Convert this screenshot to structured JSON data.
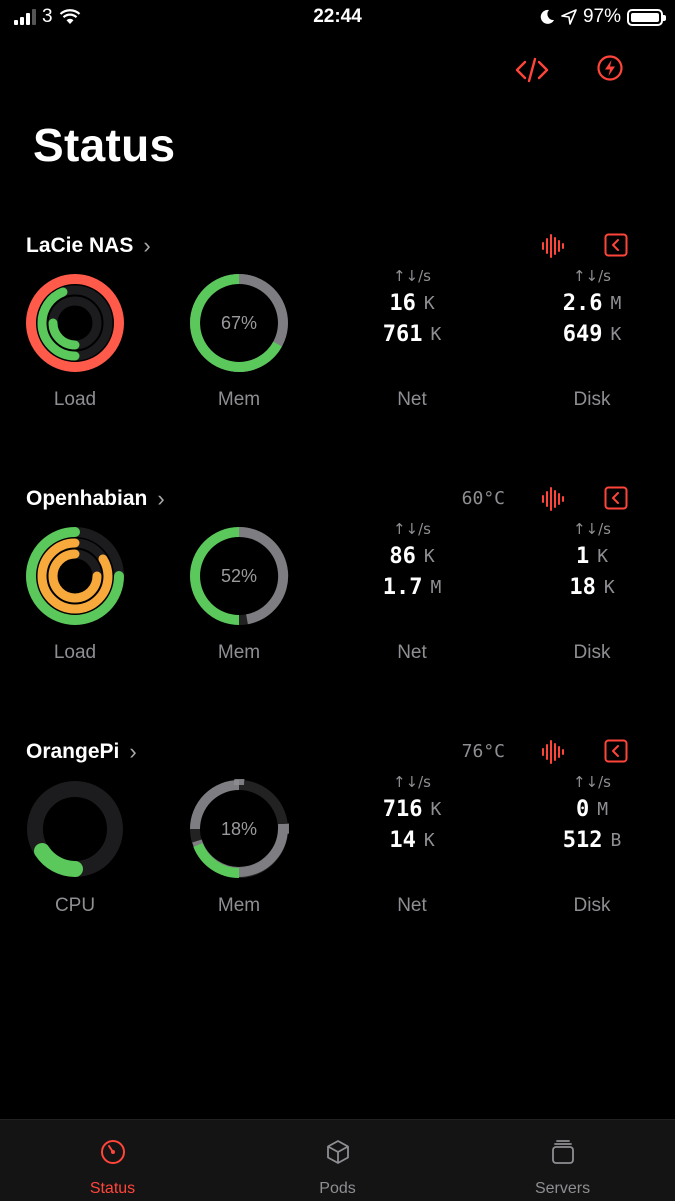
{
  "status_bar": {
    "carrier": "3",
    "time": "22:44",
    "battery": "97%"
  },
  "page": {
    "title": "Status"
  },
  "colors": {
    "accent": "#ff453a",
    "green": "#5ac85a",
    "orange": "#f7a93b",
    "track": "#2a2a2c",
    "gray": "#8e8e93"
  },
  "servers": [
    {
      "name": "LaCie NAS",
      "temp": "",
      "gauge1_label": "Load",
      "mem_pct": "67%",
      "mem_label": "Mem",
      "net": {
        "arrows": "↑↓/s",
        "up": "16",
        "up_unit": "K",
        "down": "761",
        "down_unit": "K",
        "label": "Net"
      },
      "disk": {
        "arrows": "↑↓/s",
        "read": "2.6",
        "read_unit": "M",
        "write": "649",
        "write_unit": "K",
        "label": "Disk"
      }
    },
    {
      "name": "Openhabian",
      "temp": "60°C",
      "gauge1_label": "Load",
      "mem_pct": "52%",
      "mem_label": "Mem",
      "net": {
        "arrows": "↑↓/s",
        "up": "86",
        "up_unit": "K",
        "down": "1.7",
        "down_unit": "M",
        "label": "Net"
      },
      "disk": {
        "arrows": "↑↓/s",
        "read": "1",
        "read_unit": "K",
        "write": "18",
        "write_unit": "K",
        "label": "Disk"
      }
    },
    {
      "name": "OrangePi",
      "temp": "76°C",
      "gauge1_label": "CPU",
      "mem_pct": "18%",
      "mem_label": "Mem",
      "net": {
        "arrows": "↑↓/s",
        "up": "716",
        "up_unit": "K",
        "down": "14",
        "down_unit": "K",
        "label": "Net"
      },
      "disk": {
        "arrows": "↑↓/s",
        "read": "0",
        "read_unit": "M",
        "write": "512",
        "write_unit": "B",
        "label": "Disk"
      }
    }
  ],
  "tabs": [
    {
      "label": "Status",
      "icon": "gauge-icon",
      "active": true
    },
    {
      "label": "Pods",
      "icon": "cube-icon",
      "active": false
    },
    {
      "label": "Servers",
      "icon": "stack-icon",
      "active": false
    }
  ]
}
